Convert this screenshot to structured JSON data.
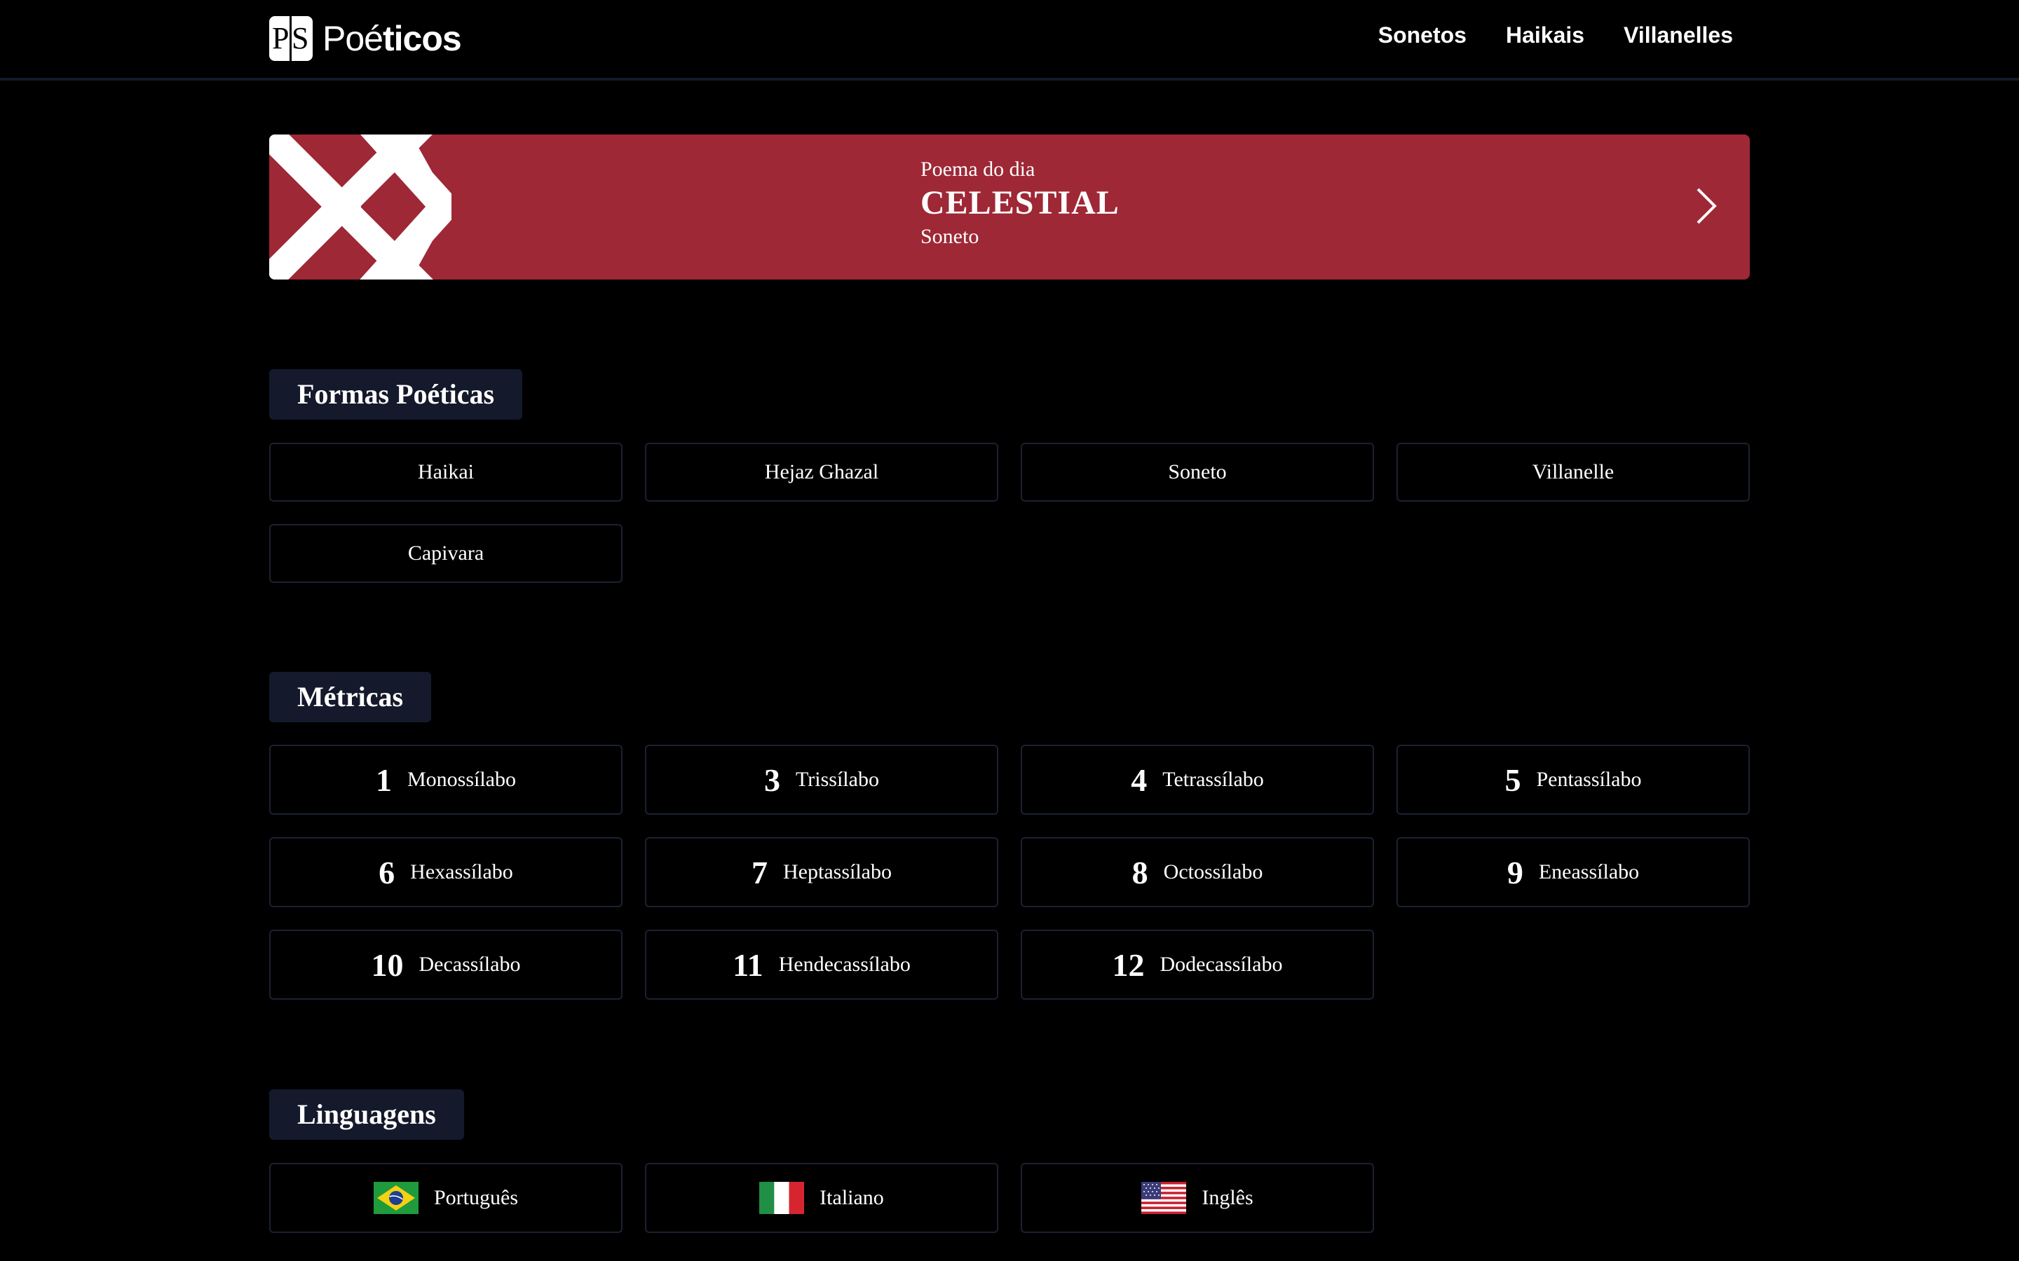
{
  "header": {
    "logo_mark_p": "P",
    "logo_mark_s": "S",
    "logo_text_light": "Poé",
    "logo_text_bold": "ticos",
    "nav": [
      "Sonetos",
      "Haikais",
      "Villanelles"
    ]
  },
  "banner": {
    "label": "Poema do dia",
    "title": "CELESTIAL",
    "subtitle": "Soneto",
    "color": "#9e2836"
  },
  "sections": {
    "forms": {
      "title": "Formas Poéticas",
      "items": [
        "Haikai",
        "Hejaz Ghazal",
        "Soneto",
        "Villanelle",
        "Capivara"
      ]
    },
    "metrics": {
      "title": "Métricas",
      "items": [
        {
          "num": "1",
          "label": "Monossílabo"
        },
        {
          "num": "3",
          "label": "Trissílabo"
        },
        {
          "num": "4",
          "label": "Tetrassílabo"
        },
        {
          "num": "5",
          "label": "Pentassílabo"
        },
        {
          "num": "6",
          "label": "Hexassílabo"
        },
        {
          "num": "7",
          "label": "Heptassílabo"
        },
        {
          "num": "8",
          "label": "Octossílabo"
        },
        {
          "num": "9",
          "label": "Eneassílabo"
        },
        {
          "num": "10",
          "label": "Decassílabo"
        },
        {
          "num": "11",
          "label": "Hendecassílabo"
        },
        {
          "num": "12",
          "label": "Dodecassílabo"
        }
      ]
    },
    "languages": {
      "title": "Linguagens",
      "items": [
        {
          "label": "Português",
          "flag": "brazil-flag-icon"
        },
        {
          "label": "Italiano",
          "flag": "italy-flag-icon"
        },
        {
          "label": "Inglês",
          "flag": "usa-flag-icon"
        }
      ]
    }
  },
  "colors": {
    "background": "#000000",
    "section_title_bg": "#141a2b",
    "card_border": "#1b2132",
    "accent": "#9e2836"
  }
}
